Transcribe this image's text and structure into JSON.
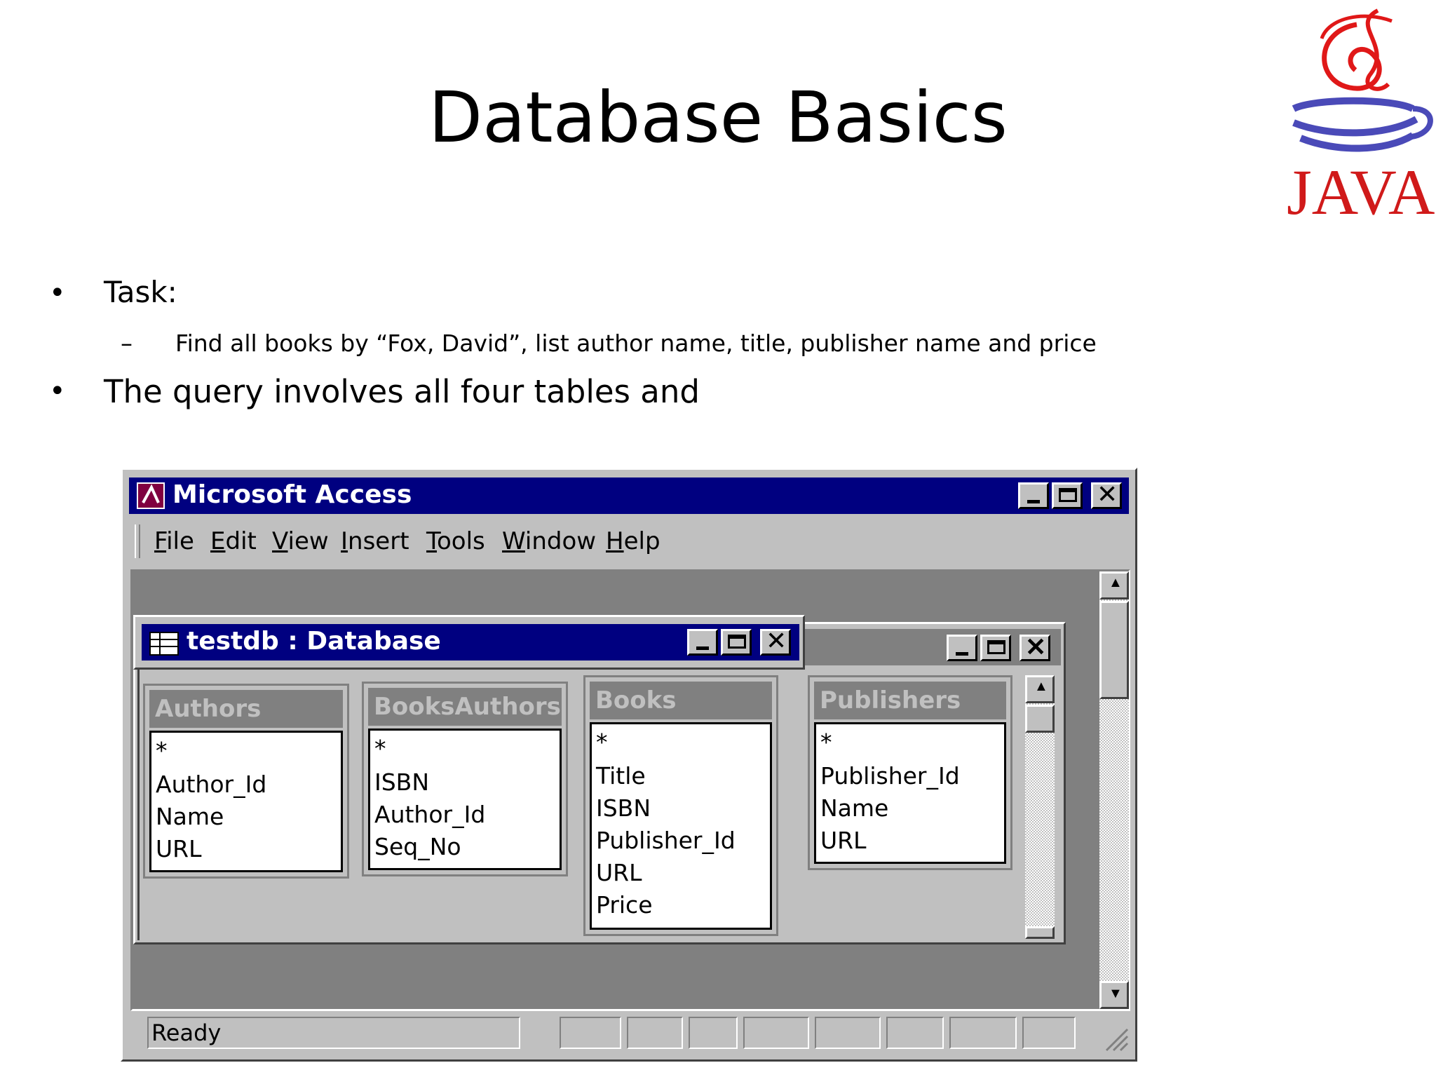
{
  "slide": {
    "title": "Database Basics",
    "bullets": [
      {
        "marker": "•",
        "text": "Task:"
      },
      {
        "marker": "–",
        "text": "Find all books by “Fox, David”, list author name, title, publisher name and price"
      },
      {
        "marker": "•",
        "text": "The query involves all four tables and"
      }
    ],
    "logo_text": "JAVA"
  },
  "app": {
    "title": "Microsoft Access",
    "menu": [
      "File",
      "Edit",
      "View",
      "Insert",
      "Tools",
      "Window",
      "Help"
    ],
    "status": "Ready"
  },
  "db_window": {
    "title": "testdb : Database"
  },
  "tables": [
    {
      "name": "Authors",
      "fields": [
        "*",
        "Author_Id",
        "Name",
        "URL"
      ]
    },
    {
      "name": "BooksAuthors",
      "fields": [
        "*",
        "ISBN",
        "Author_Id",
        "Seq_No"
      ]
    },
    {
      "name": "Books",
      "fields": [
        "*",
        "Title",
        "ISBN",
        "Publisher_Id",
        "URL",
        "Price"
      ]
    },
    {
      "name": "Publishers",
      "fields": [
        "*",
        "Publisher_Id",
        "Name",
        "URL"
      ]
    }
  ],
  "colors": {
    "titlebar": "#000080",
    "face": "#c0c0c0",
    "workspace": "#808080"
  }
}
